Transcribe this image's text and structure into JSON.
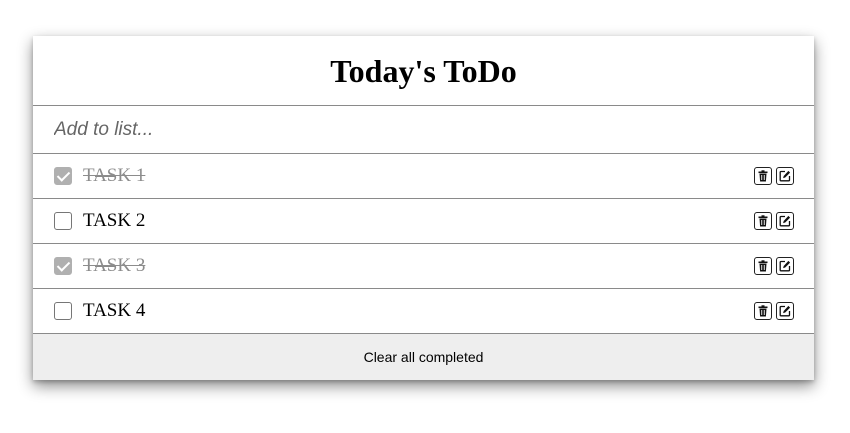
{
  "header": {
    "title": "Today's ToDo"
  },
  "add": {
    "placeholder": "Add to list..."
  },
  "tasks": [
    {
      "label": "TASK 1",
      "completed": true
    },
    {
      "label": "TASK 2",
      "completed": false
    },
    {
      "label": "TASK 3",
      "completed": true
    },
    {
      "label": "TASK 4",
      "completed": false
    }
  ],
  "footer": {
    "clear_label": "Clear all completed"
  },
  "icons": {
    "delete": "trash-icon",
    "edit": "edit-icon"
  },
  "colors": {
    "completed_text": "#8c8c8c",
    "footer_bg": "#eeeeee",
    "divider": "#8a8a8a"
  }
}
